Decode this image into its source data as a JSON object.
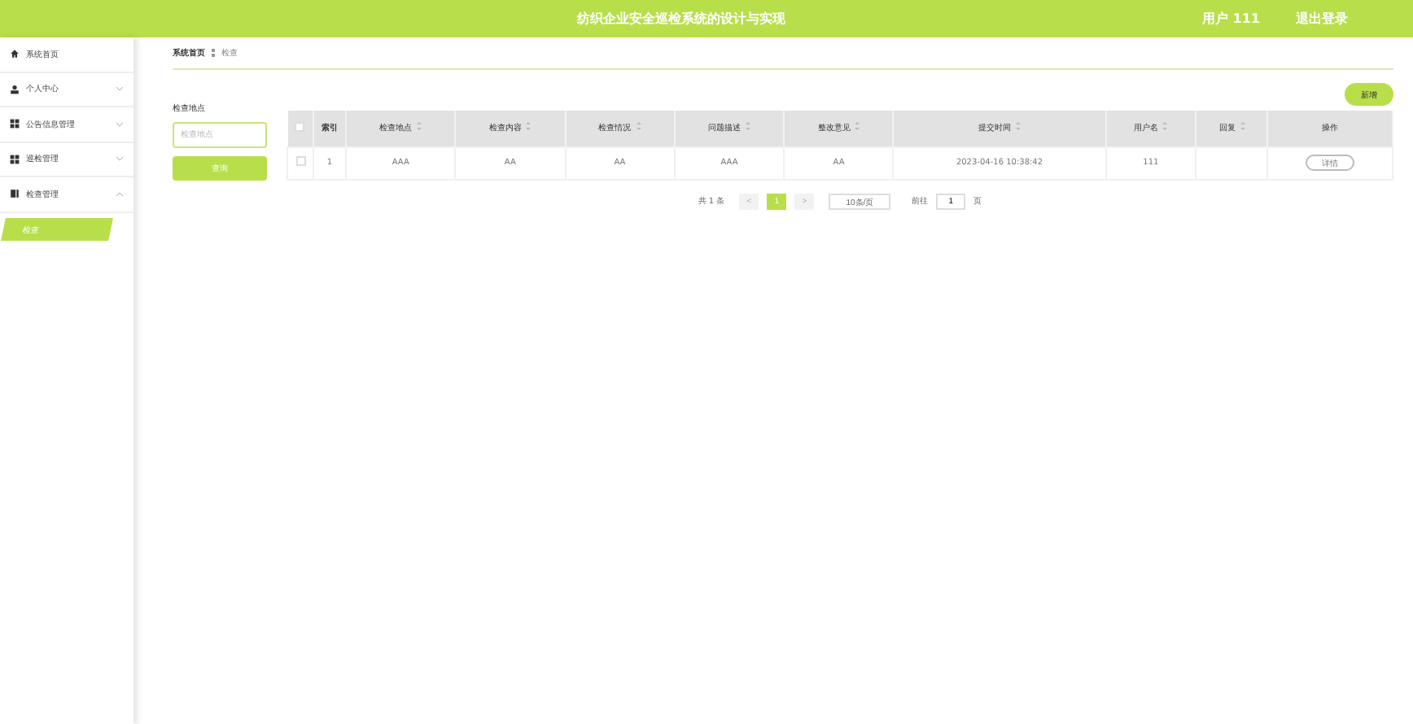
{
  "header": {
    "title": "纺织企业安全巡检系统的设计与实现",
    "user": "用户 111",
    "logout": "退出登录"
  },
  "sidebar": {
    "items": [
      {
        "label": "系统首页"
      },
      {
        "label": "个人中心",
        "expanded": false
      },
      {
        "label": "公告信息管理",
        "expanded": false
      },
      {
        "label": "巡检管理",
        "expanded": false
      },
      {
        "label": "检查管理",
        "expanded": true,
        "children": [
          {
            "label": "检查",
            "selected": true
          }
        ]
      }
    ]
  },
  "breadcrumb": [
    "系统首页",
    "检查"
  ],
  "search": {
    "label": "检查地点",
    "placeholder": "检查地点",
    "button": "查询"
  },
  "add_button": "新增",
  "table": {
    "all_checked": false,
    "columns": [
      {
        "label": "索引",
        "sortable": false
      },
      {
        "label": "检查地点",
        "sortable": true
      },
      {
        "label": "检查内容",
        "sortable": true
      },
      {
        "label": "检查情况",
        "sortable": true
      },
      {
        "label": "问题描述",
        "sortable": true
      },
      {
        "label": "整改意见",
        "sortable": true
      },
      {
        "label": "提交时间",
        "sortable": true
      },
      {
        "label": "用户名",
        "sortable": true
      },
      {
        "label": "回复",
        "sortable": true
      },
      {
        "label": "操作",
        "sortable": false
      }
    ],
    "rows": [
      {
        "checked": false,
        "cells": [
          "1",
          "AAA",
          "AA",
          "AA",
          "AAA",
          "AA",
          "2023-04-16 10:38:42",
          "111",
          ""
        ],
        "action": "详情"
      }
    ]
  },
  "pagination": {
    "total": "共 1 条",
    "prev": "<",
    "pages": [
      {
        "label": "1",
        "selected": true
      }
    ],
    "next": ">",
    "page_size": "10条/页",
    "goto": "前往",
    "goto_value": "1",
    "page_unit": "页"
  }
}
